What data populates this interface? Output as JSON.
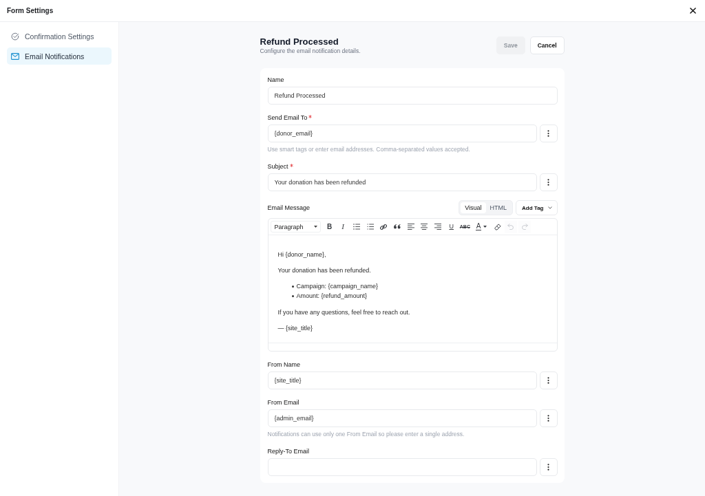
{
  "window": {
    "title": "Form Settings"
  },
  "sidebar": {
    "items": [
      {
        "label": "Confirmation Settings",
        "kind": "check",
        "selected": false
      },
      {
        "label": "Email Notifications",
        "kind": "mail",
        "selected": true
      }
    ]
  },
  "header": {
    "title": "Refund Processed",
    "subtitle": "Configure the email notification details.",
    "buttons": [
      {
        "label": "Save",
        "kind": "primary",
        "disabled": true
      },
      {
        "label": "Cancel",
        "kind": "secondary",
        "disabled": false
      }
    ]
  },
  "fields": [
    {
      "kind": "text",
      "label": "Name",
      "required": false,
      "value": "Refund Processed",
      "menu_button": false
    },
    {
      "kind": "text",
      "label": "Send Email To",
      "required": true,
      "value": "{donor_email}",
      "menu_button": true,
      "help": "Use smart tags or enter email addresses. Comma-separated values accepted."
    },
    {
      "kind": "text",
      "label": "Subject",
      "required": true,
      "value": "Your donation has been refunded",
      "menu_button": true
    },
    {
      "kind": "editor",
      "label": "Email Message",
      "required": false,
      "modes": [
        {
          "label": "Visual",
          "selected": true
        },
        {
          "label": "HTML",
          "selected": false
        }
      ],
      "add_tag": "Add Tag",
      "toolbar": {
        "format": "Paragraph",
        "buttons": [
          {
            "kind": "bold",
            "glyph": "B",
            "disabled": false
          },
          {
            "kind": "italic",
            "glyph": "I",
            "disabled": false
          },
          {
            "kind": "bullet-list",
            "disabled": false
          },
          {
            "kind": "numbered-list",
            "disabled": false
          },
          {
            "kind": "link",
            "disabled": false
          },
          {
            "kind": "quote",
            "disabled": false
          },
          {
            "kind": "align-left",
            "disabled": false
          },
          {
            "kind": "align-center",
            "disabled": false
          },
          {
            "kind": "align-right",
            "disabled": false
          },
          {
            "kind": "underline",
            "glyph": "U",
            "disabled": false
          },
          {
            "kind": "strikethrough",
            "glyph": "ABC",
            "disabled": false
          },
          {
            "kind": "text-color",
            "glyph": "A",
            "disabled": false
          },
          {
            "kind": "clear-format",
            "disabled": false
          },
          {
            "kind": "undo",
            "disabled": true
          },
          {
            "kind": "redo",
            "disabled": true
          }
        ]
      },
      "body": [
        {
          "kind": "paragraph",
          "text": "Hi {donor_name},"
        },
        {
          "kind": "paragraph",
          "text": "Your donation has been refunded."
        },
        {
          "kind": "list",
          "items": [
            "Campaign: {campaign_name}",
            "Amount: {refund_amount}"
          ]
        },
        {
          "kind": "paragraph",
          "text": "If you have any questions, feel free to reach out."
        },
        {
          "kind": "paragraph",
          "text": "— {site_title}"
        }
      ]
    },
    {
      "kind": "text",
      "label": "From Name",
      "required": false,
      "value": "{site_title}",
      "menu_button": true
    },
    {
      "kind": "text",
      "label": "From Email",
      "required": false,
      "value": "{admin_email}",
      "menu_button": true,
      "help": "Notifications can use only one From Email so please enter a single address."
    },
    {
      "kind": "text",
      "label": "Reply-To Email",
      "required": false,
      "menu_button": true
    }
  ]
}
